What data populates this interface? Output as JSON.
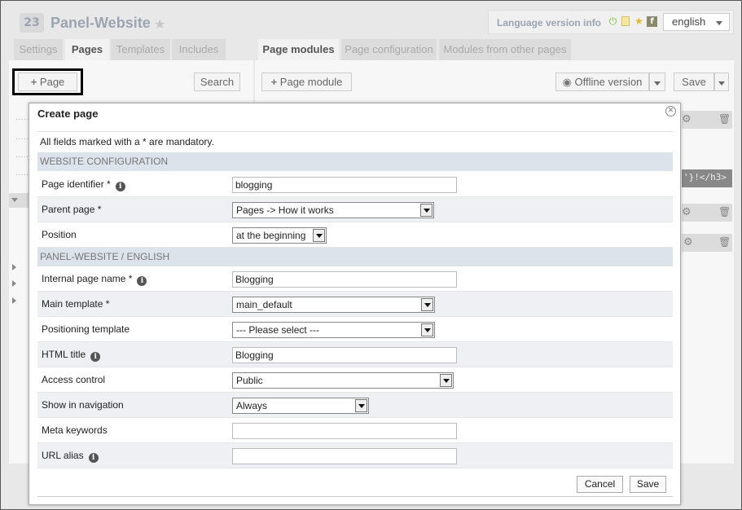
{
  "header": {
    "site_number": "23",
    "site_title": "Panel-Website",
    "language_info": "Language version info",
    "language": "english"
  },
  "left_tabs": [
    "Settings",
    "Pages",
    "Templates",
    "Includes"
  ],
  "right_tabs": [
    "Page modules",
    "Page configuration",
    "Modules from other pages"
  ],
  "toolbar": {
    "add_page": "Page",
    "search": "Search",
    "add_module": "Page module",
    "offline": "Offline version",
    "save": "Save"
  },
  "code_snippet": "'}!</h3>",
  "dialog": {
    "title": "Create page",
    "mandatory_note": "All fields marked with a * are mandatory.",
    "section_1": "WEBSITE CONFIGURATION",
    "section_2": "PANEL-WEBSITE / ENGLISH",
    "fields": {
      "page_identifier": {
        "label": "Page identifier *",
        "value": "blogging"
      },
      "parent_page": {
        "label": "Parent page *",
        "value": "Pages -> How it works"
      },
      "position": {
        "label": "Position",
        "value": "at the beginning"
      },
      "internal_name": {
        "label": "Internal page name *",
        "value": "Blogging"
      },
      "main_template": {
        "label": "Main template *",
        "value": "main_default"
      },
      "positioning_template": {
        "label": "Positioning template",
        "value": "--- Please select ---"
      },
      "html_title": {
        "label": "HTML title",
        "value": "Blogging"
      },
      "access_control": {
        "label": "Access control",
        "value": "Public"
      },
      "show_in_navigation": {
        "label": "Show in navigation",
        "value": "Always"
      },
      "meta_keywords": {
        "label": "Meta keywords",
        "value": ""
      },
      "url_alias": {
        "label": "URL alias",
        "value": ""
      }
    },
    "cancel": "Cancel",
    "save": "Save"
  }
}
